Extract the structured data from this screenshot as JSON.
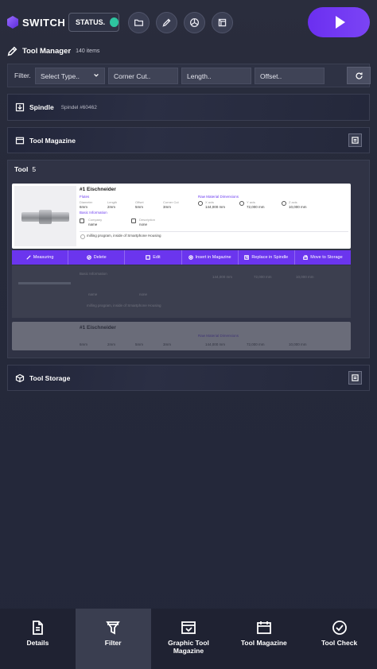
{
  "header": {
    "logo_text": "SWITCH",
    "status_label": "STATUS.",
    "status_color": "#2ec4a0",
    "icons": [
      "folder-icon",
      "pencil-icon",
      "aperture-icon",
      "cube-icon"
    ],
    "play_icon": "play-icon",
    "accent_color": "#6b2ff0"
  },
  "tool_manager": {
    "title": "Tool Manager",
    "count": "140 items"
  },
  "filters": {
    "label": "Filter.",
    "type_placeholder": "Select Type..",
    "corner_placeholder": "Corner Cut..",
    "length_placeholder": "Length..",
    "offset_placeholder": "Offset.."
  },
  "spindle": {
    "title": "Spindle",
    "subtitle": "Spindel #60462"
  },
  "magazine": {
    "title": "Tool Magazine"
  },
  "tools": {
    "title": "Tool",
    "count": "5",
    "card": {
      "title": "#1 Eischneider",
      "flutes_label": "Flutes",
      "diameter_label": "Diameter",
      "diameter_value": "6mm",
      "length_label": "Length",
      "length_value": "2mm",
      "offset_label": "Offset",
      "offset_value": "5mm",
      "corner_label": "Corner Cut",
      "corner_value": "3mm",
      "raw_label": "Raw Material Dimensions",
      "x_label": "X axis",
      "x_value": "144,000 mm",
      "y_label": "Y axis",
      "y_value": "72,000 mm",
      "z_label": "Z axis",
      "z_value": "10,000 mm",
      "basic_label": "Basic Information",
      "company_label": "Company",
      "company_value": "name",
      "description_label": "Description",
      "description_value": "none",
      "note": "milling program, inside of Smartphone Housing"
    },
    "ghost_card": {
      "title": "#1 Eischneider",
      "basic_label": "Basic Information",
      "raw_label": "Raw Material Dimensions",
      "company_value": "name",
      "description_value": "none",
      "x_value": "144,000 mm",
      "y_value": "72,000 mm",
      "z_value": "10,000 mm",
      "diameter_value": "6mm",
      "length_value": "2mm",
      "offset_value": "5mm",
      "corner_value": "3mm",
      "note": "milling program, inside of Smartphone Housing"
    },
    "actions": [
      "Measuring",
      "Delete",
      "Edit",
      "Insert in Magazine",
      "Replace in Spindle",
      "Move to Storage"
    ]
  },
  "storage": {
    "title": "Tool Storage"
  },
  "bottom_nav": [
    {
      "label": "Details",
      "icon": "document-icon"
    },
    {
      "label": "Filter",
      "icon": "filter-icon"
    },
    {
      "label": "Graphic Tool Magazine",
      "icon": "graphic-magazine-icon"
    },
    {
      "label": "Tool Magazine",
      "icon": "magazine-icon"
    },
    {
      "label": "Tool Check",
      "icon": "check-icon"
    }
  ]
}
